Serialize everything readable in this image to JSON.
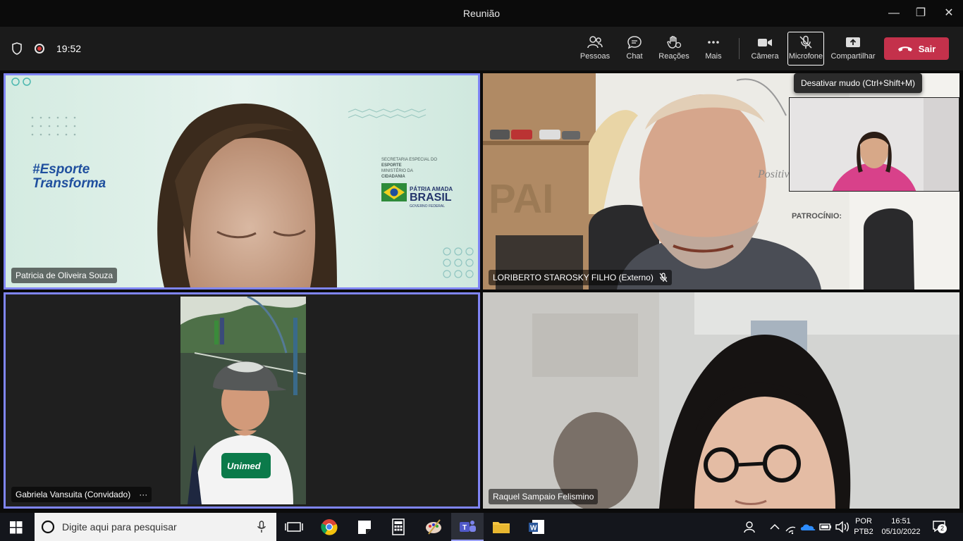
{
  "window": {
    "title": "Reunião",
    "minimize": "—",
    "maximize": "❐",
    "close": "✕"
  },
  "toolbar": {
    "timer": "19:52",
    "people": "Pessoas",
    "chat": "Chat",
    "reactions": "Reações",
    "more": "Mais",
    "camera": "Câmera",
    "mic": "Microfone",
    "share": "Compartilhar",
    "leave": "Sair"
  },
  "tooltip": "Desativar mudo (Ctrl+Shift+M)",
  "participants": [
    {
      "name": "Patricia de Oliveira Souza"
    },
    {
      "name": "LORIBERTO STAROSKY FILHO (Externo)"
    },
    {
      "name": "Gabriela Vansuita (Convidado)",
      "more": "···"
    },
    {
      "name": "Raquel Sampaio Felismino"
    }
  ],
  "background_slide": {
    "hashtag_line1": "#Esporte",
    "hashtag_line2": "Transforma",
    "gov1": "SECRETARIA ESPECIAL DO",
    "gov2": "ESPORTE",
    "gov3": "MINISTÉRIO DA",
    "gov4": "CIDADANIA",
    "brand1": "PÁTRIA AMADA",
    "brand2": "BRASIL",
    "brand3": "GOVERNO FEDERAL"
  },
  "loriberto_bg": {
    "banner": "Positiva e Gratidão - PodCast",
    "sponsor": "PATROCÍNIO:",
    "letters": "PAI"
  },
  "kid_shirt": "Unimed",
  "taskbar": {
    "search_placeholder": "Digite aqui para pesquisar",
    "lang1": "POR",
    "lang2": "PTB2",
    "time": "16:51",
    "date": "05/10/2022",
    "notifications": "2"
  },
  "colors": {
    "accent": "#7f85f5",
    "leave": "#c4314b"
  }
}
